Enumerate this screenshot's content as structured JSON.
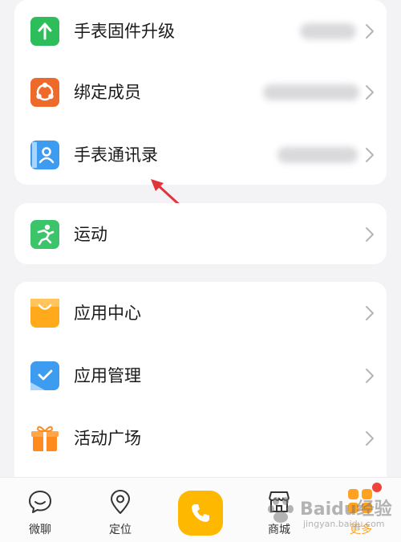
{
  "menu": {
    "group1": [
      {
        "label": "手表固件升级",
        "icon": "upload-arrow-icon",
        "color": "#2ebd5b"
      },
      {
        "label": "绑定成员",
        "icon": "share-members-icon",
        "color": "#ee6a2a"
      },
      {
        "label": "手表通讯录",
        "icon": "contacts-book-icon",
        "color": "#3d9cf0"
      }
    ],
    "group2": [
      {
        "label": "运动",
        "icon": "running-person-icon",
        "color": "#3cc46a"
      }
    ],
    "group3": [
      {
        "label": "应用中心",
        "icon": "shopping-bag-icon",
        "color": "#ffaa1a"
      },
      {
        "label": "应用管理",
        "icon": "checkbox-icon",
        "color": "#3d9cf0"
      },
      {
        "label": "活动广场",
        "icon": "gift-icon",
        "color": "#ff8a1e"
      }
    ]
  },
  "tabbar": {
    "chat": {
      "label": "微聊",
      "icon": "chat-bubble-icon"
    },
    "location": {
      "label": "定位",
      "icon": "location-pin-icon"
    },
    "call": {
      "icon": "phone-icon",
      "color": "#ffb800"
    },
    "mall": {
      "label": "商城",
      "icon": "store-icon"
    },
    "more": {
      "label": "更多",
      "icon": "apps-grid-icon",
      "color": "#ffa21f"
    }
  },
  "annotation": {
    "color": "#e0353b"
  },
  "watermark": {
    "brand": "Baidu经验",
    "url": "jingyan.baidu.com"
  }
}
